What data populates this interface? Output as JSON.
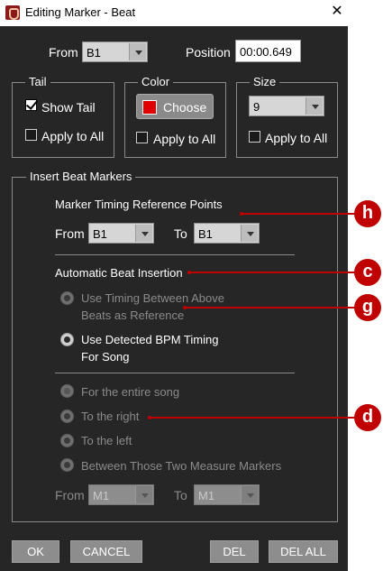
{
  "window": {
    "title": "Editing Marker - Beat",
    "icon": "app-logo-icon",
    "close_icon": "close-icon"
  },
  "top": {
    "from_label": "From",
    "from_value": "B1",
    "position_label": "Position",
    "position_value": "00:00.649"
  },
  "tail": {
    "title": "Tail",
    "show_tail_label": "Show Tail",
    "show_tail_checked": true,
    "apply_label": "Apply to All",
    "apply_checked": false
  },
  "color": {
    "title": "Color",
    "choose_label": "Choose",
    "swatch_color": "#e00000",
    "apply_label": "Apply to All",
    "apply_checked": false
  },
  "size": {
    "title": "Size",
    "value": "9",
    "apply_label": "Apply to All",
    "apply_checked": false
  },
  "insert": {
    "title": "Insert Beat Markers",
    "timing_heading": "Marker Timing Reference Points",
    "from_label": "From",
    "from_value": "B1",
    "to_label": "To",
    "to_value": "B1",
    "auto_heading": "Automatic Beat Insertion",
    "option_between_line1": "Use Timing Between Above",
    "option_between_line2": "Beats as Reference",
    "option_bpm_line1": "Use Detected BPM Timing",
    "option_bpm_line2": "For Song",
    "scope_entire": "For the entire song",
    "scope_right": "To the right",
    "scope_left": "To the left",
    "scope_between": "Between Those Two Measure Markers",
    "range_from_label": "From",
    "range_from_value": "M1",
    "range_to_label": "To",
    "range_to_value": "M1"
  },
  "footer": {
    "ok": "OK",
    "cancel": "CANCEL",
    "del": "DEL",
    "del_all": "DEL ALL"
  },
  "callouts": {
    "h": "h",
    "c": "c",
    "g": "g",
    "d": "d",
    "color": "#c00000"
  }
}
